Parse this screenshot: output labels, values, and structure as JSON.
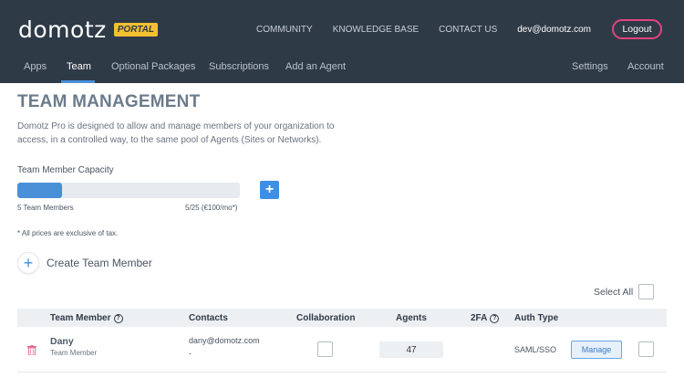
{
  "header": {
    "logo_text": "domotz",
    "badge": "PORTAL",
    "links": [
      "COMMUNITY",
      "KNOWLEDGE BASE",
      "CONTACT US"
    ],
    "user_email": "dev@domotz.com",
    "logout_label": "Logout"
  },
  "nav": {
    "items": [
      {
        "label": "Apps",
        "active": false
      },
      {
        "label": "Team",
        "active": true
      },
      {
        "label": "Optional Packages",
        "active": false
      },
      {
        "label": "Subscriptions",
        "active": false
      },
      {
        "label": "Add an Agent",
        "active": false
      }
    ],
    "right_items": [
      {
        "label": "Settings"
      },
      {
        "label": "Account"
      }
    ]
  },
  "page": {
    "title": "TEAM MANAGEMENT",
    "description": "Domotz Pro is designed to allow and manage members of your organization to access, in a controlled way, to the same pool of Agents (Sites or Networks).",
    "capacity_label": "Team Member Capacity",
    "capacity_fill_fraction": 0.2,
    "capacity_members": "5 Team Members",
    "capacity_plan": "5/25 (€100/mo*)",
    "tax_note": "* All prices are exclusive of tax.",
    "create_label": "Create Team Member",
    "select_all_label": "Select All"
  },
  "table": {
    "columns": [
      "Team Member",
      "Contacts",
      "Collaboration",
      "Agents",
      "2FA",
      "Auth Type"
    ],
    "rows": [
      {
        "name": "Dany",
        "role": "Team Member",
        "email": "dany@domotz.com",
        "phone": "-",
        "agents": "47",
        "auth_type": "SAML/SSO",
        "manage_label": "Manage"
      }
    ]
  },
  "colors": {
    "header_bg": "#2f3a47",
    "accent": "#4a90d9",
    "logout_border": "#e0457b",
    "badge": "#f3c030",
    "trash": "#e06a8c"
  },
  "icons": [
    "question-circle-icon",
    "plus-icon",
    "trash-icon"
  ]
}
